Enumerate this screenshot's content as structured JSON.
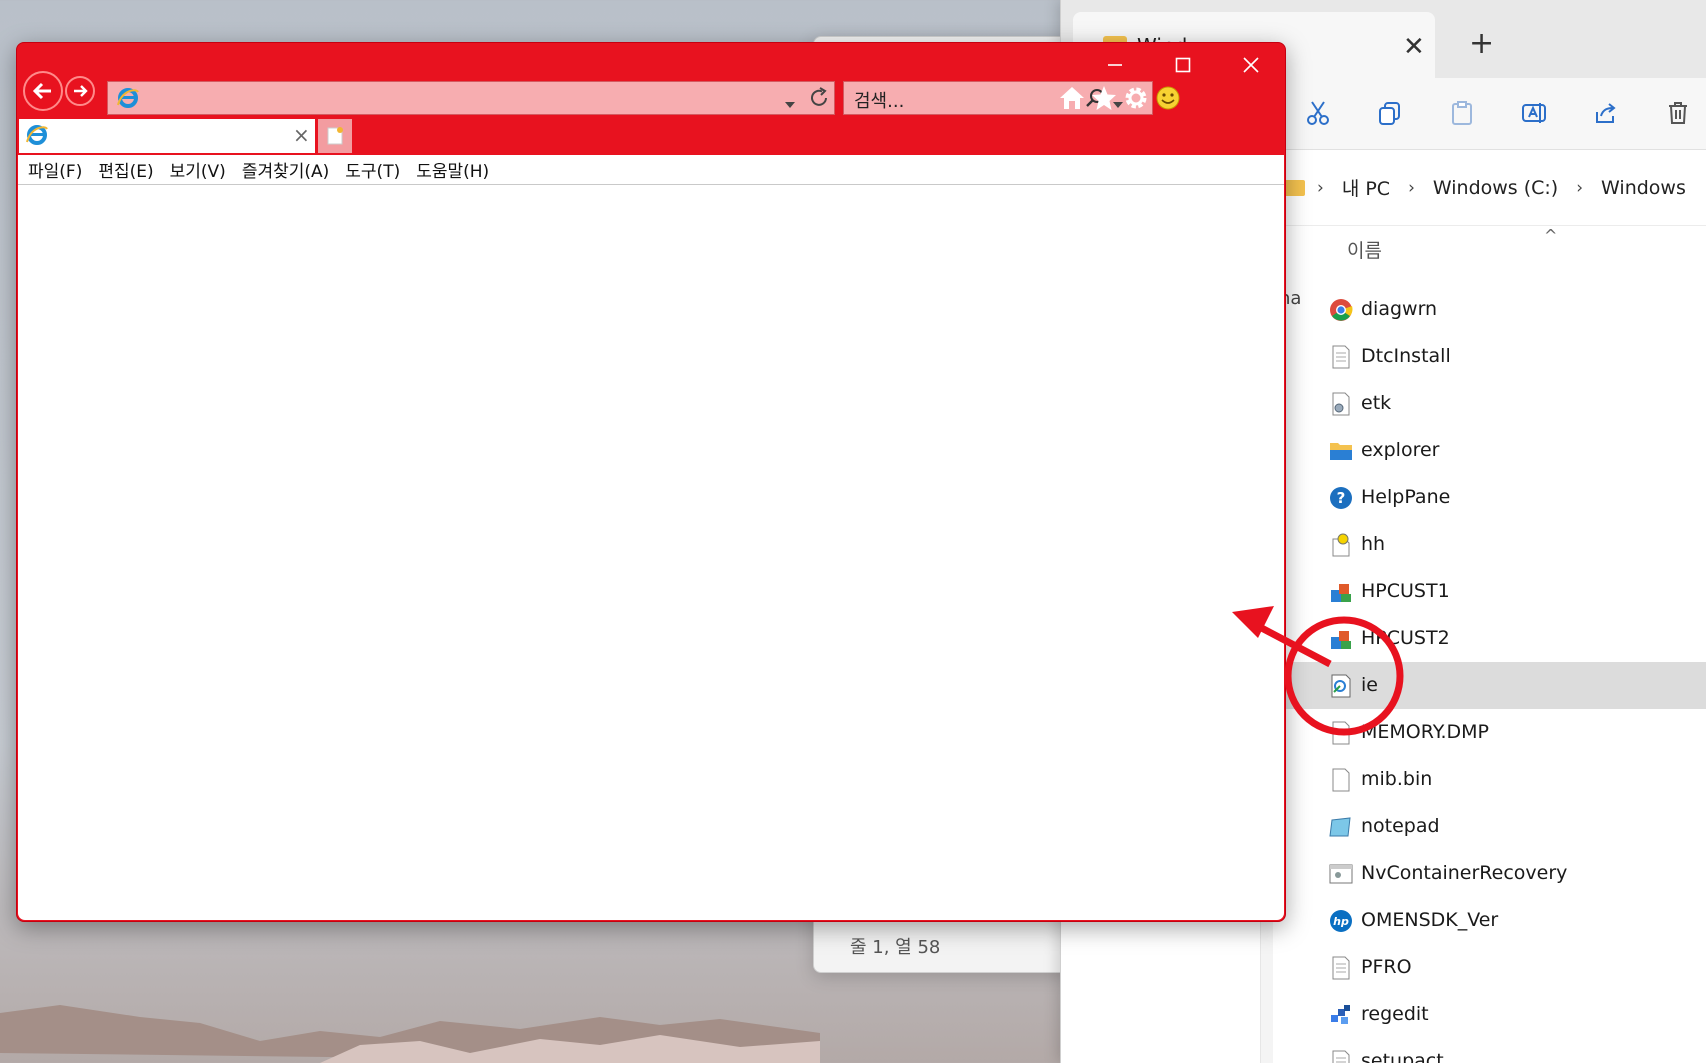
{
  "notepad": {
    "status": "줄 1, 열 58"
  },
  "explorer": {
    "tab_title": "Wind",
    "tab_close": "✕",
    "new_tab": "+",
    "breadcrumbs": [
      "내 PC",
      "Windows (C:)",
      "Windows"
    ],
    "breadcrumb_sep": "›",
    "column_name": "이름",
    "sort_caret": "^",
    "nav_fragment": "na",
    "files": [
      {
        "name": "diagwrn",
        "icon": "chrome-icon"
      },
      {
        "name": "DtcInstall",
        "icon": "text-file-icon"
      },
      {
        "name": "etk",
        "icon": "settings-file-icon"
      },
      {
        "name": "explorer",
        "icon": "folder-icon"
      },
      {
        "name": "HelpPane",
        "icon": "help-icon"
      },
      {
        "name": "hh",
        "icon": "help-file-icon"
      },
      {
        "name": "HPCUST1",
        "icon": "installer-icon"
      },
      {
        "name": "HPCUST2",
        "icon": "installer-icon"
      },
      {
        "name": "ie",
        "icon": "ie-shortcut-icon",
        "selected": true
      },
      {
        "name": "MEMORY.DMP",
        "icon": "blank-file-icon"
      },
      {
        "name": "mib.bin",
        "icon": "blank-file-icon"
      },
      {
        "name": "notepad",
        "icon": "notepad-icon"
      },
      {
        "name": "NvContainerRecovery",
        "icon": "app-window-icon"
      },
      {
        "name": "OMENSDK_Ver",
        "icon": "hp-icon"
      },
      {
        "name": "PFRO",
        "icon": "text-file-icon"
      },
      {
        "name": "regedit",
        "icon": "regedit-icon"
      },
      {
        "name": "setupact",
        "icon": "text-file-icon"
      }
    ]
  },
  "ie": {
    "search_placeholder": "검색...",
    "tab_close": "×",
    "menu": [
      "파일(F)",
      "편집(E)",
      "보기(V)",
      "즐겨찾기(A)",
      "도구(T)",
      "도움말(H)"
    ],
    "colors": {
      "frame": "#e8121f",
      "address_bg": "#f7adb0",
      "annotation": "#e8121f"
    }
  }
}
